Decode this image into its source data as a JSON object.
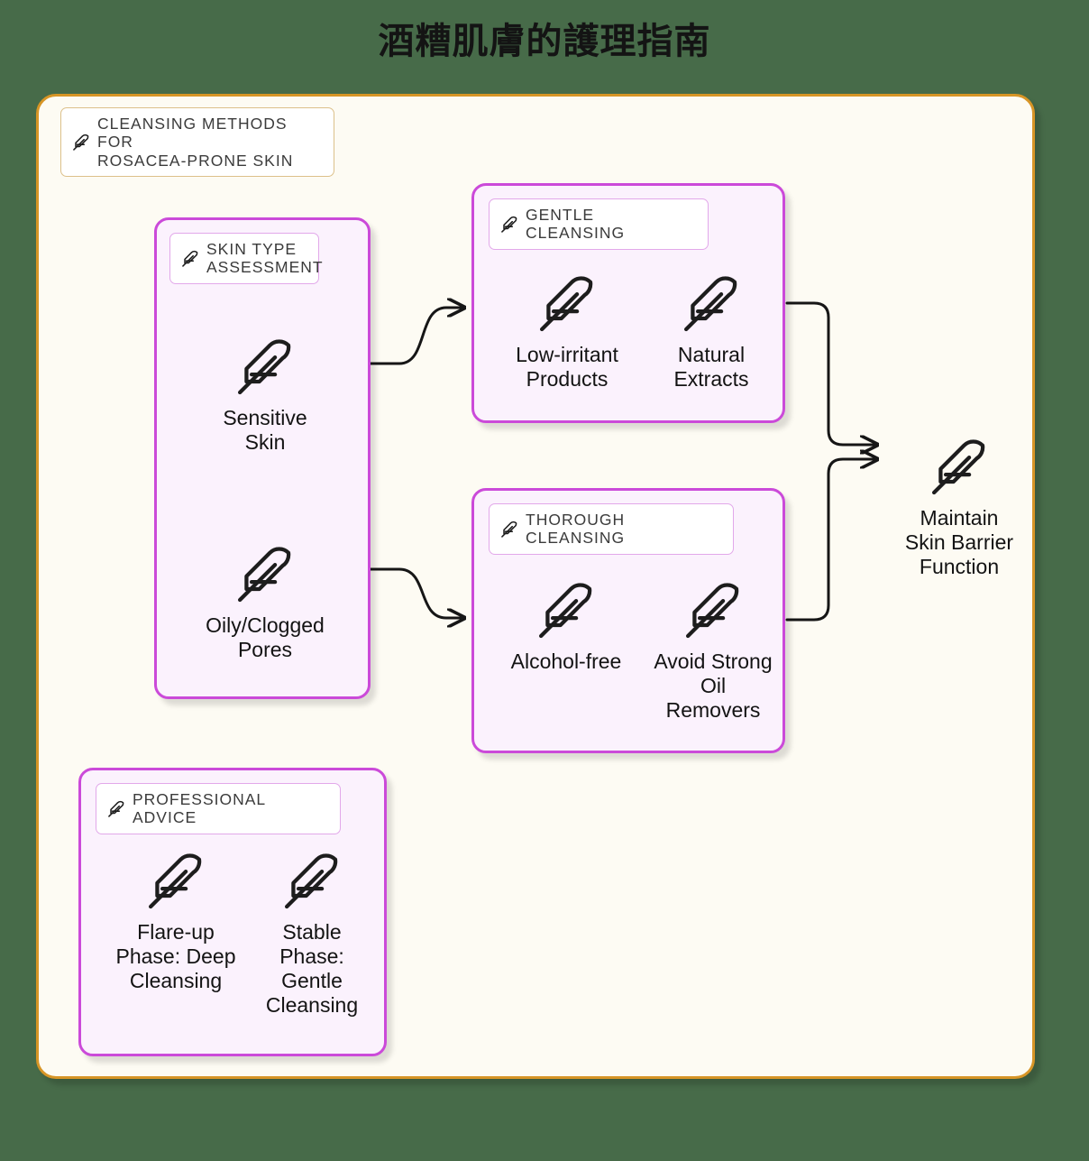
{
  "title": "酒糟肌膚的護理指南",
  "colors": {
    "page_background": "#476b49",
    "frame_border": "#d79526",
    "frame_background": "#fdfbf3",
    "group_border": "#cb4ad9",
    "group_background": "#fbf2fd",
    "chip_background": "#ffffff",
    "chip_border_outer": "#dcc08a",
    "chip_border_group": "#e2a8ea",
    "text": "#131313",
    "chip_text": "#3b3b3b",
    "connector": "#161616"
  },
  "frame": {
    "chip": {
      "icon": "feather-icon",
      "label": "CLEANSING METHODS FOR\nROSACEA-PRONE SKIN"
    }
  },
  "groups": [
    {
      "id": "skin-type-assessment",
      "chip": {
        "icon": "feather-icon",
        "label": "SKIN TYPE\nASSESSMENT"
      },
      "nodes": [
        {
          "id": "sensitive-skin",
          "icon": "feather-icon",
          "label": "Sensitive\nSkin"
        },
        {
          "id": "oily-clogged-pores",
          "icon": "feather-icon",
          "label": "Oily/Clogged\nPores"
        }
      ]
    },
    {
      "id": "gentle-cleansing",
      "chip": {
        "icon": "feather-icon",
        "label": "GENTLE CLEANSING"
      },
      "nodes": [
        {
          "id": "low-irritant-products",
          "icon": "feather-icon",
          "label": "Low-irritant\nProducts"
        },
        {
          "id": "natural-extracts",
          "icon": "feather-icon",
          "label": "Natural\nExtracts"
        }
      ]
    },
    {
      "id": "thorough-cleansing",
      "chip": {
        "icon": "feather-icon",
        "label": "THOROUGH CLEANSING"
      },
      "nodes": [
        {
          "id": "alcohol-free",
          "icon": "feather-icon",
          "label": "Alcohol-free"
        },
        {
          "id": "avoid-strong-oil-removers",
          "icon": "feather-icon",
          "label": "Avoid Strong\nOil\nRemovers"
        }
      ]
    },
    {
      "id": "professional-advice",
      "chip": {
        "icon": "feather-icon",
        "label": "PROFESSIONAL ADVICE"
      },
      "nodes": [
        {
          "id": "flare-up-phase",
          "icon": "feather-icon",
          "label": "Flare-up\nPhase: Deep\nCleansing"
        },
        {
          "id": "stable-phase",
          "icon": "feather-icon",
          "label": "Stable\nPhase:\nGentle\nCleansing"
        }
      ]
    }
  ],
  "outcome": {
    "id": "maintain-skin-barrier-function",
    "icon": "feather-icon",
    "label": "Maintain\nSkin Barrier\nFunction"
  },
  "connections": [
    {
      "from": "sensitive-skin",
      "to": "gentle-cleansing"
    },
    {
      "from": "oily-clogged-pores",
      "to": "thorough-cleansing"
    },
    {
      "from": "gentle-cleansing",
      "to": "maintain-skin-barrier-function"
    },
    {
      "from": "thorough-cleansing",
      "to": "maintain-skin-barrier-function"
    }
  ]
}
